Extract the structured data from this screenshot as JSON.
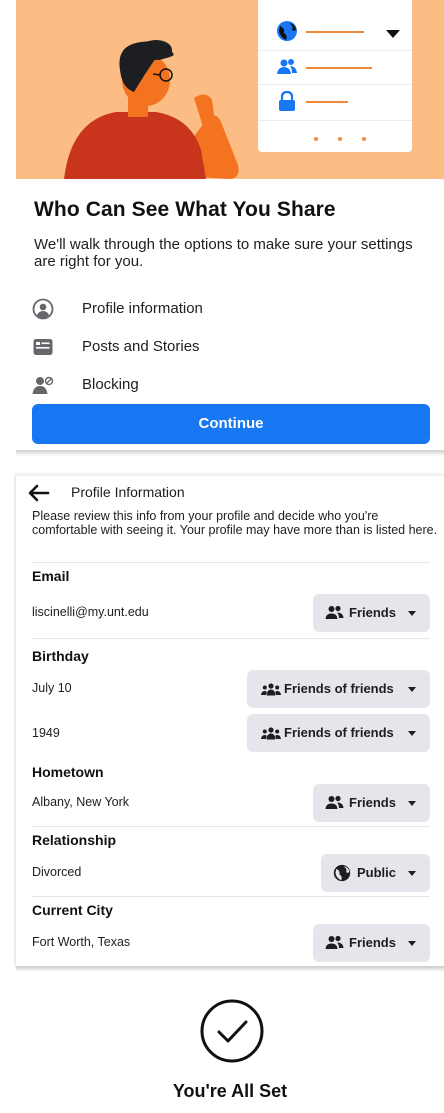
{
  "intro": {
    "title": "Who Can See What You Share",
    "description": "We'll walk through the options to make sure your settings are right for you.",
    "options": [
      {
        "label": "Profile information",
        "icon": "person-circle-icon"
      },
      {
        "label": "Posts and Stories",
        "icon": "posts-icon"
      },
      {
        "label": "Blocking",
        "icon": "blocking-icon"
      }
    ],
    "continue_label": "Continue"
  },
  "profile_info": {
    "title": "Profile Information",
    "description": "Please review this info from your profile and decide who you're comfortable with seeing it. Your profile may have more than is listed here.",
    "sections": [
      {
        "heading": "Email",
        "items": [
          {
            "value": "liscinelli@my.unt.edu",
            "audience": "Friends",
            "audience_icon": "friends-icon"
          }
        ]
      },
      {
        "heading": "Birthday",
        "items": [
          {
            "value": "July 10",
            "audience": "Friends of friends",
            "audience_icon": "friends-of-friends-icon"
          },
          {
            "value": "1949",
            "audience": "Friends of friends",
            "audience_icon": "friends-of-friends-icon"
          }
        ]
      },
      {
        "heading": "Hometown",
        "items": [
          {
            "value": "Albany, New York",
            "audience": "Friends",
            "audience_icon": "friends-icon"
          }
        ]
      },
      {
        "heading": "Relationship",
        "items": [
          {
            "value": "Divorced",
            "audience": "Public",
            "audience_icon": "globe-icon"
          }
        ]
      },
      {
        "heading": "Current City",
        "items": [
          {
            "value": "Fort Worth, Texas",
            "audience": "Friends",
            "audience_icon": "friends-icon"
          }
        ]
      }
    ]
  },
  "done": {
    "title": "You're All Set"
  },
  "colors": {
    "brand_blue": "#1877f2",
    "hero_bg": "#fbbd83",
    "button_gray": "#e4e6eb"
  }
}
